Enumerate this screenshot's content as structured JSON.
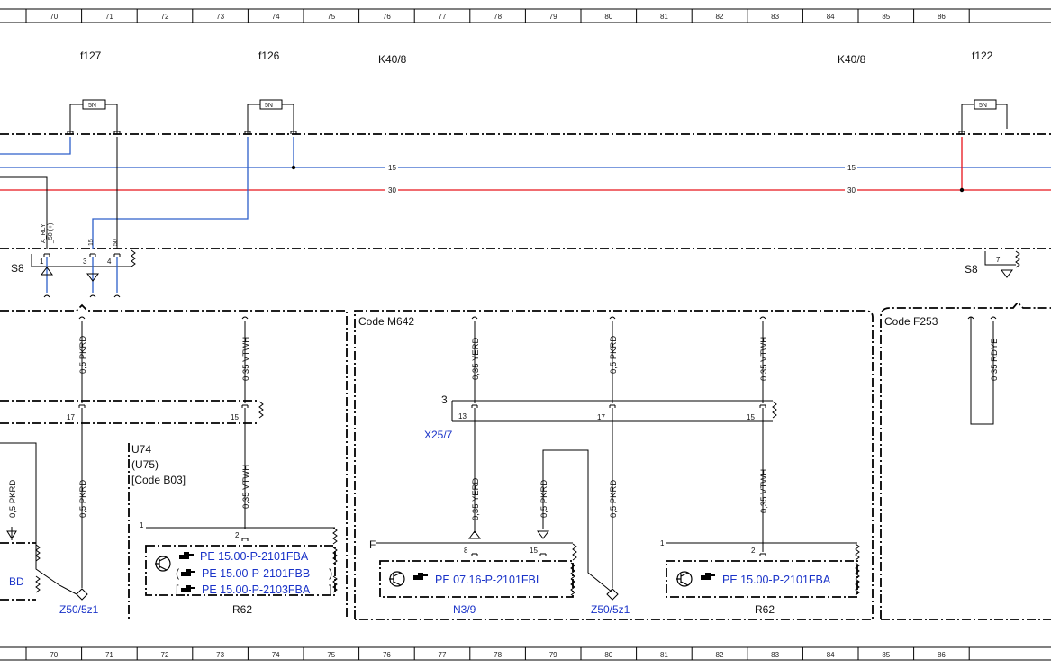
{
  "ruler": {
    "labels": [
      "70",
      "71",
      "72",
      "73",
      "74",
      "75",
      "76",
      "77",
      "78",
      "79",
      "80",
      "81",
      "82",
      "83",
      "84",
      "85",
      "86"
    ]
  },
  "headers": {
    "f127": "f127",
    "f126": "f126",
    "k40_left": "K40/8",
    "k40_right": "K40/8",
    "f122": "f122"
  },
  "fuse": {
    "rating": "5N"
  },
  "bus": {
    "line15": "15",
    "line30": "30"
  },
  "s8": {
    "label": "S8",
    "pin_labels": [
      "A_RLY",
      "_50 (+)",
      "15",
      "50"
    ],
    "pins": [
      "1",
      "3",
      "4"
    ],
    "right_pin": "7"
  },
  "sections": {
    "code_m642": "Code M642",
    "code_f253": "Code F253"
  },
  "wires": {
    "pkrd": "0,5 PKRD",
    "vtwh": "0,35 VTWH",
    "yerd": "0,35 YERD",
    "pkrd_small": "0,5 PKRD",
    "rdye": "0,35 RDYE"
  },
  "connector_pins": {
    "p17": "17",
    "p15": "15",
    "p13": "13",
    "p3": "3",
    "p2": "2",
    "p1": "1",
    "p8": "8",
    "pF": "F"
  },
  "components": {
    "x25_7": "X25/7",
    "u74": "U74",
    "u75": "(U75)",
    "code_b03": "[Code B03]",
    "bd": "BD",
    "z50_left": "Z50/5z1",
    "z50_mid": "Z50/5z1",
    "n3_9": "N3/9",
    "r62_left": "R62",
    "r62_right": "R62"
  },
  "references": {
    "u74_ref1": "PE 15.00-P-2101FBA",
    "u74_ref2": "PE 15.00-P-2101FBB",
    "u74_ref3": "PE 15.00-P-2103FBA",
    "n39_ref": "PE 07.16-P-2101FBI",
    "r62_ref": "PE 15.00-P-2101FBA"
  },
  "colors": {
    "wire_blue": "#2d5fc9",
    "wire_red": "#e8141b",
    "link_blue": "#1a33c8",
    "line_black": "#000000"
  },
  "icons": [
    "transistor-icon",
    "pointing-hand-icon",
    "ground-symbol-icon",
    "fuse-icon",
    "plug-arrow-icon"
  ]
}
